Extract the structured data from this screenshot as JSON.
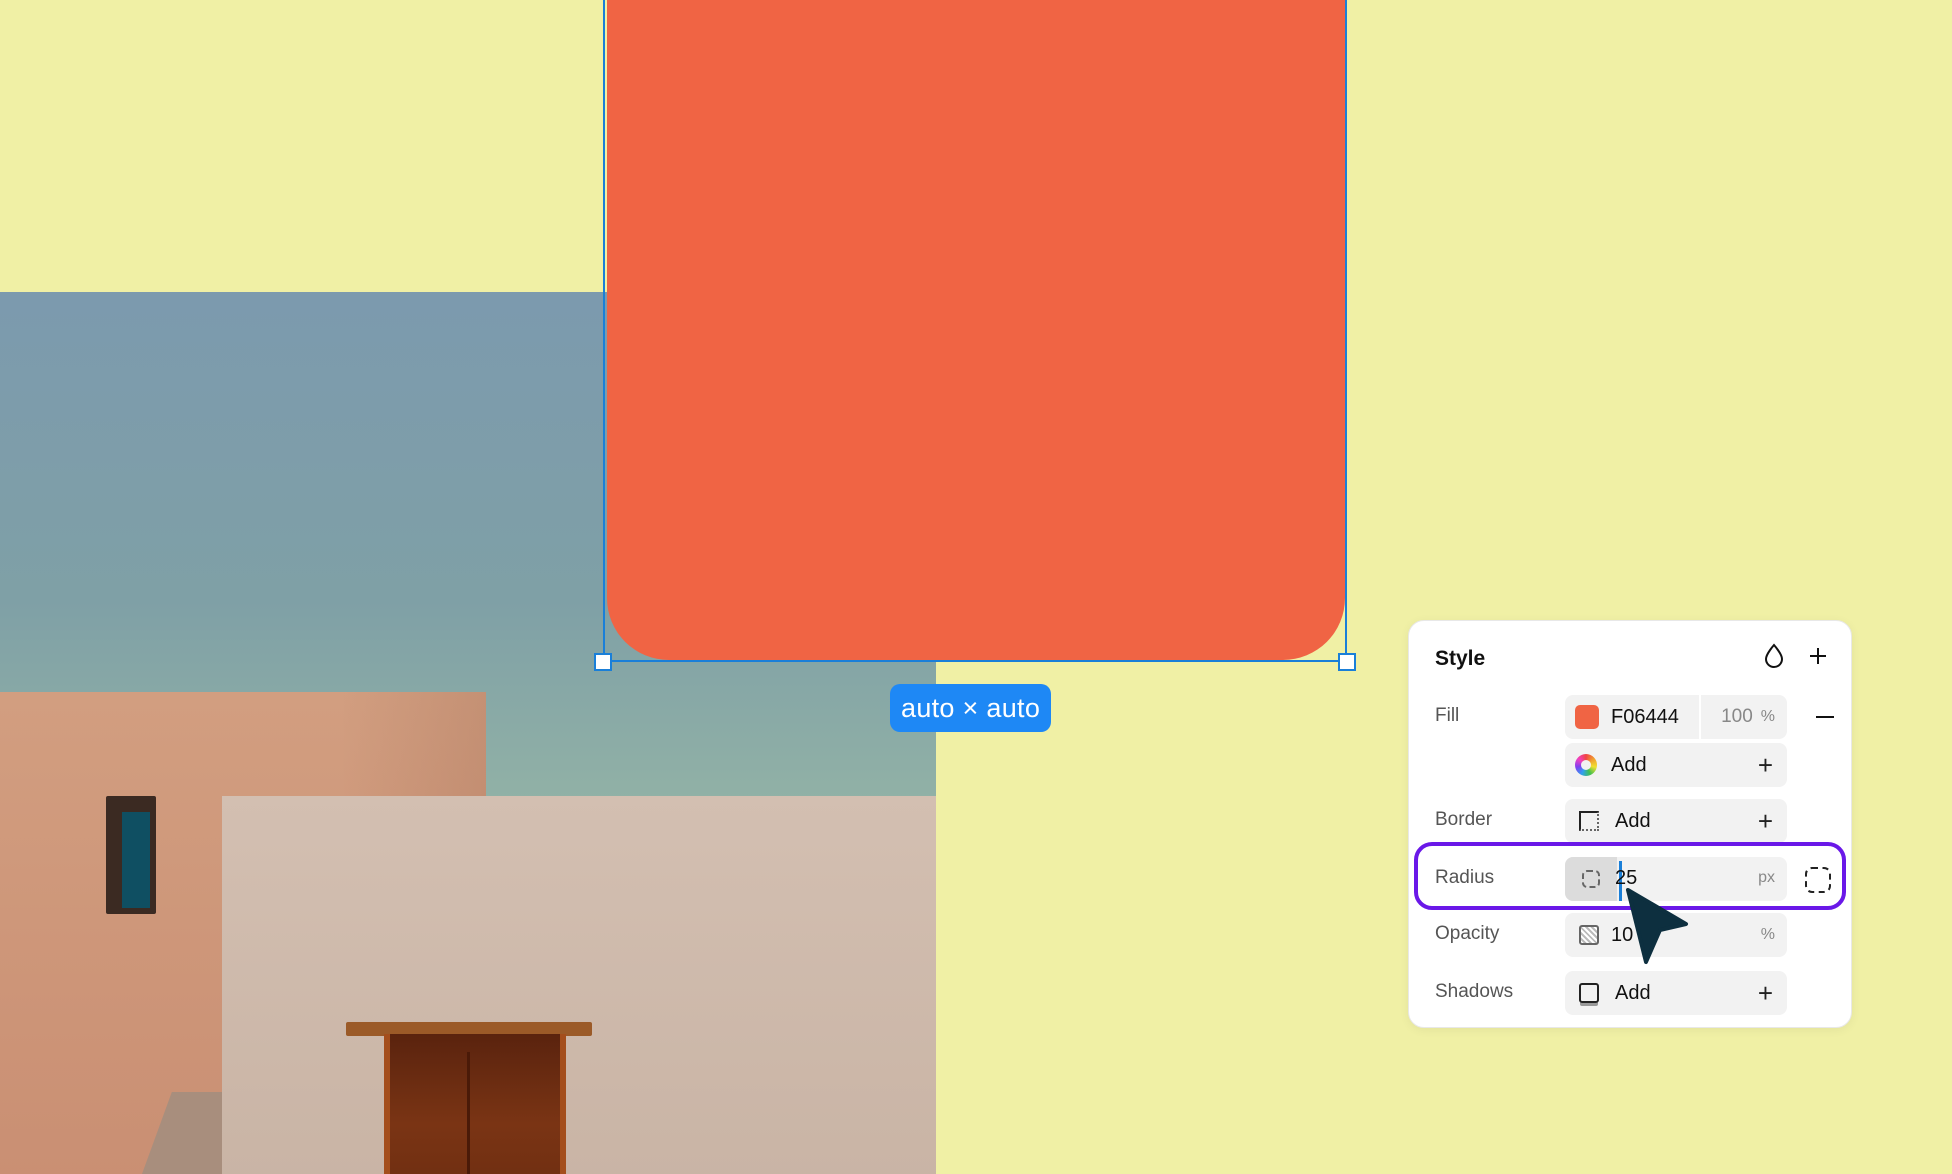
{
  "canvas": {
    "shape_color": "#F06444",
    "dimension_badge": "auto × auto"
  },
  "style_panel": {
    "title": "Style",
    "header_icons": [
      "drop-icon",
      "plus-icon"
    ],
    "fill": {
      "label": "Fill",
      "hex": "F06444",
      "opacity_value": "100",
      "opacity_unit": "%",
      "add_label": "Add"
    },
    "border": {
      "label": "Border",
      "add_label": "Add"
    },
    "radius": {
      "label": "Radius",
      "value": "25",
      "unit": "px"
    },
    "opacity": {
      "label": "Opacity",
      "value": "10",
      "unit": "%"
    },
    "shadows": {
      "label": "Shadows",
      "add_label": "Add"
    }
  },
  "colors": {
    "accent": "#1E88F5",
    "highlight": "#6A18E8",
    "background": "#F0F0A5"
  }
}
